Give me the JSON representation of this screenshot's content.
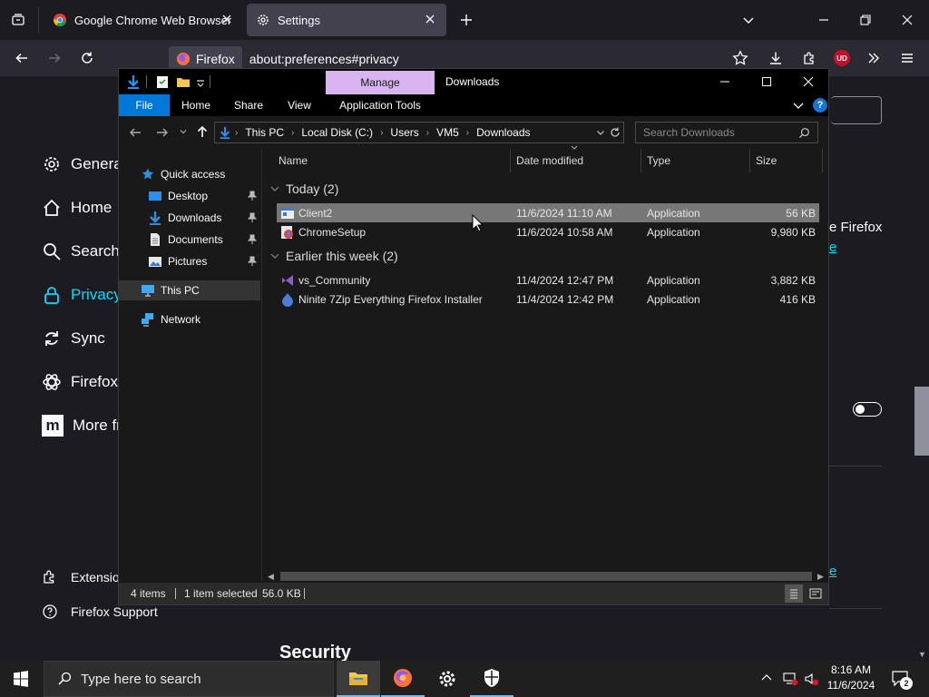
{
  "browser": {
    "tabs": [
      {
        "title": "Google Chrome Web Browser"
      },
      {
        "title": "Settings"
      }
    ],
    "identity_label": "Firefox",
    "url": "about:preferences#privacy",
    "ublock_badge": "UD"
  },
  "ff_page": {
    "categories": [
      "General",
      "Home",
      "Search",
      "Privacy",
      "Sync",
      "Firefox",
      "More fr"
    ],
    "bottom_links": [
      "Extensions",
      "Firefox Support"
    ],
    "section_heading": "Security",
    "partial_text_1": "e Firefox",
    "partial_text_2": "e",
    "partial_text_3": "e"
  },
  "explorer": {
    "title": "Downloads",
    "manage_tab": "Manage",
    "ribbon_tabs": [
      "File",
      "Home",
      "Share",
      "View",
      "Application Tools"
    ],
    "breadcrumb": [
      "This PC",
      "Local Disk (C:)",
      "Users",
      "VM5",
      "Downloads"
    ],
    "search_placeholder": "Search Downloads",
    "nav": {
      "quick_access": "Quick access",
      "quick_items": [
        "Desktop",
        "Downloads",
        "Documents",
        "Pictures"
      ],
      "this_pc": "This PC",
      "network": "Network"
    },
    "columns": [
      "Name",
      "Date modified",
      "Type",
      "Size"
    ],
    "groups": [
      {
        "label": "Today (2)",
        "files": [
          {
            "name": "Client2",
            "date": "11/6/2024 11:10 AM",
            "type": "Application",
            "size": "56 KB"
          },
          {
            "name": "ChromeSetup",
            "date": "11/6/2024 10:58 AM",
            "type": "Application",
            "size": "9,980 KB"
          }
        ]
      },
      {
        "label": "Earlier this week (2)",
        "files": [
          {
            "name": "vs_Community",
            "date": "11/4/2024 12:47 PM",
            "type": "Application",
            "size": "3,882 KB"
          },
          {
            "name": "Ninite 7Zip Everything Firefox Installer",
            "date": "11/4/2024 12:42 PM",
            "type": "Application",
            "size": "416 KB"
          }
        ]
      }
    ],
    "status": {
      "items": "4 items",
      "selected": "1 item selected",
      "sel_size": "56.0 KB"
    }
  },
  "taskbar": {
    "search_placeholder": "Type here to search",
    "time": "8:16 AM",
    "date": "11/6/2024",
    "notif_count": "2"
  },
  "colors": {
    "accent": "#0078d7",
    "manage_tab": "#d8b4f0",
    "firefox_link": "#00ddff"
  }
}
